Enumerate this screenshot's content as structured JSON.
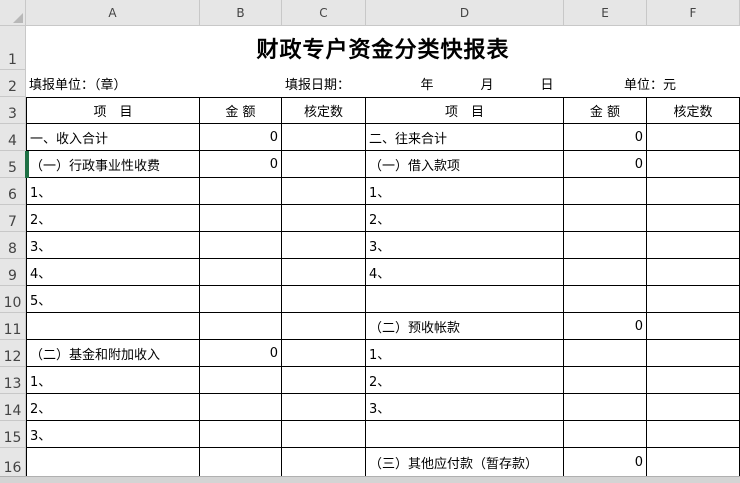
{
  "columns": [
    "A",
    "B",
    "C",
    "D",
    "E",
    "F"
  ],
  "rows": [
    "1",
    "2",
    "3",
    "4",
    "5",
    "6",
    "7",
    "8",
    "9",
    "10",
    "11",
    "12",
    "13",
    "14",
    "15",
    "16"
  ],
  "sheet": {
    "title": "财政专户资金分类快报表",
    "fill_unit": "填报单位：（章）",
    "fill_date": "填报日期：",
    "year": "年",
    "month": "月",
    "day": "日",
    "unit": "单位：元",
    "hdr_item": "项　目",
    "hdr_amount": "金 额",
    "hdr_verified": "核定数",
    "left": [
      {
        "label": "一、收入合计",
        "amount": "0"
      },
      {
        "label": "（一）行政事业性收费",
        "amount": "0"
      },
      {
        "label": "1、",
        "amount": ""
      },
      {
        "label": "2、",
        "amount": ""
      },
      {
        "label": "3、",
        "amount": ""
      },
      {
        "label": "4、",
        "amount": ""
      },
      {
        "label": "5、",
        "amount": ""
      },
      {
        "label": "",
        "amount": ""
      },
      {
        "label": "（二）基金和附加收入",
        "amount": "0"
      },
      {
        "label": "1、",
        "amount": ""
      },
      {
        "label": "2、",
        "amount": ""
      },
      {
        "label": "3、",
        "amount": ""
      },
      {
        "label": "",
        "amount": ""
      }
    ],
    "right": [
      {
        "label": "二、往来合计",
        "amount": "0"
      },
      {
        "label": "（一）借入款项",
        "amount": "0"
      },
      {
        "label": "1、",
        "amount": ""
      },
      {
        "label": "2、",
        "amount": ""
      },
      {
        "label": "3、",
        "amount": ""
      },
      {
        "label": "4、",
        "amount": ""
      },
      {
        "label": "",
        "amount": ""
      },
      {
        "label": "（二）预收帐款",
        "amount": "0"
      },
      {
        "label": "1、",
        "amount": ""
      },
      {
        "label": "2、",
        "amount": ""
      },
      {
        "label": "3、",
        "amount": ""
      },
      {
        "label": "",
        "amount": ""
      },
      {
        "label": "（三）其他应付款（暂存款）",
        "amount": "0"
      }
    ]
  }
}
